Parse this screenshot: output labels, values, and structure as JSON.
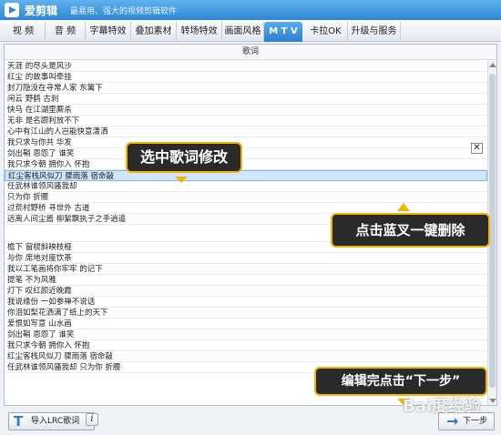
{
  "titlebar": {
    "app_name": "爱剪辑",
    "slogan": "最易用、强大的视频剪辑软件"
  },
  "tabs": [
    {
      "label": "视  频"
    },
    {
      "label": "音  频"
    },
    {
      "label": "字幕特效"
    },
    {
      "label": "叠加素材"
    },
    {
      "label": "转场特效"
    },
    {
      "label": "画面风格"
    },
    {
      "label": "M T V"
    },
    {
      "label": "卡拉OK"
    },
    {
      "label": "升级与服务"
    }
  ],
  "active_tab": "M T V",
  "panel": {
    "header": "歌词"
  },
  "lyrics": [
    "天涯 的尽头是风沙",
    "红尘 的故事叫牵挂",
    "封刀隐没在寻常人家 东篱下",
    "闲云 野鹤 古刹",
    "快马 在江湖里厮杀",
    "无非 是名跟利放不下",
    "心中有江山的人岂能快意潇洒",
    "我只求与你共 华发",
    "剑出鞘 恩怨了 谁笑",
    "我只求今朝 拥你入 怀抱",
    "红尘客栈风似刀 骤雨落 宿命敲",
    "任武林谁领风骚我却",
    "只为你 折腰",
    "过荒村野桥 寻世外 古道",
    "远离人间尘嚣 柳絮飘执子之手逍遥",
    "",
    "檐下 窗棂斜映枝桠",
    "与你 席地对座饮茶",
    "我以工笔画将你牢牢 的记下",
    "提笔 不为风雅",
    "灯下 叹红颜近晚霞",
    "我说缘份 一如参禅不说话",
    "你泪如梨花洒满了纸上的天下",
    "爱恨如写意 山水画",
    "剑出鞘 恩怨了 谁笑",
    "我只求今朝 拥你入 怀抱",
    "红尘客栈风似刀 骤雨落 宿命敲",
    "任武林谁领风骚我却 只为你 折腰"
  ],
  "selected_index": 10,
  "delete_button": {
    "label": "✕",
    "icon": "close-icon"
  },
  "callouts": {
    "select_lyric": "选中歌词修改",
    "delete_hint": "点击蓝叉一键删除",
    "next_hint": "编辑完点击“下一步”"
  },
  "bottom": {
    "import_label": "导入LRC歌词",
    "import_icon_glyph": "T",
    "info_label": "i",
    "next_label": "下一步"
  },
  "watermark": "Bai度经验",
  "colors": {
    "accent": "#2f86d3",
    "selected_row": "#cfe6fb",
    "callout_border": "#f5b400",
    "callout_bg": "#2a2a2a"
  }
}
